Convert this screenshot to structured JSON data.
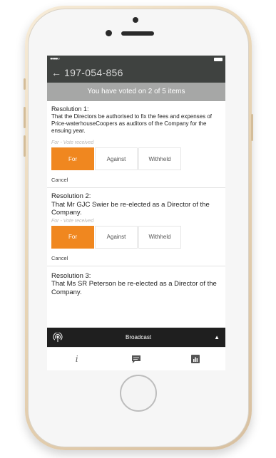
{
  "device": {
    "type": "iphone"
  },
  "status_bar": {
    "signal": "●●●●○"
  },
  "header": {
    "back_icon": "arrow-left-icon",
    "title": "197-054-856"
  },
  "vote_banner": {
    "text": "You have voted on 2 of 5 items"
  },
  "resolutions": [
    {
      "title": "Resolution 1:",
      "text": "That the Directors be authorised to fix the fees and expenses of Price-waterhouseCoopers as auditors of the Company for the ensuing year.",
      "status": "For - Vote received",
      "options": [
        "For",
        "Against",
        "Withheld"
      ],
      "selected": "For",
      "cancel": "Cancel"
    },
    {
      "title": "Resolution 2:",
      "text": "That Mr GJC Swier be re-elected as a Director of the Company.",
      "status": "For - Vote received",
      "options": [
        "For",
        "Against",
        "Withheld"
      ],
      "selected": "For",
      "cancel": "Cancel"
    },
    {
      "title": "Resolution 3:",
      "text": "That Ms SR Peterson be re-elected as a Director of the Company."
    }
  ],
  "broadcast": {
    "label": "Broadcast",
    "icon": "broadcast-icon",
    "toggle_icon": "chevron-up-icon"
  },
  "tabs": [
    {
      "icon": "info-icon",
      "glyph": "i"
    },
    {
      "icon": "chat-icon"
    },
    {
      "icon": "bar-chart-icon"
    }
  ],
  "colors": {
    "accent": "#f0871f",
    "header_bg": "#3f4240",
    "banner_bg": "#a6a7a6",
    "broadcast_bg": "#1f1f1f"
  }
}
